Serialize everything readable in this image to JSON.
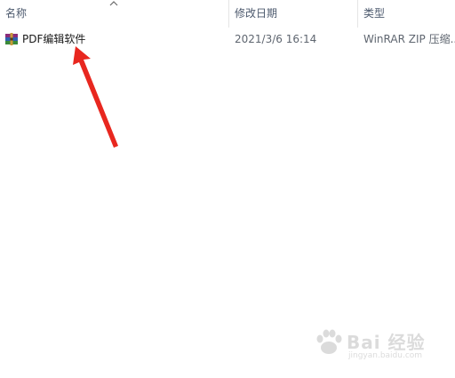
{
  "columns": {
    "name": "名称",
    "modified": "修改日期",
    "type": "类型"
  },
  "files": [
    {
      "name": "PDF编辑软件",
      "modified": "2021/3/6 16:14",
      "type": "WinRAR ZIP 压缩..."
    }
  ],
  "watermark": {
    "brand": "Bai 经验",
    "url": "jingyan.baidu.com"
  },
  "colors": {
    "annotation_arrow": "#e8271f",
    "header_text": "#4d5a6e"
  },
  "icons": {
    "sort": "chevron-up-icon",
    "file": "winrar-archive-icon"
  }
}
